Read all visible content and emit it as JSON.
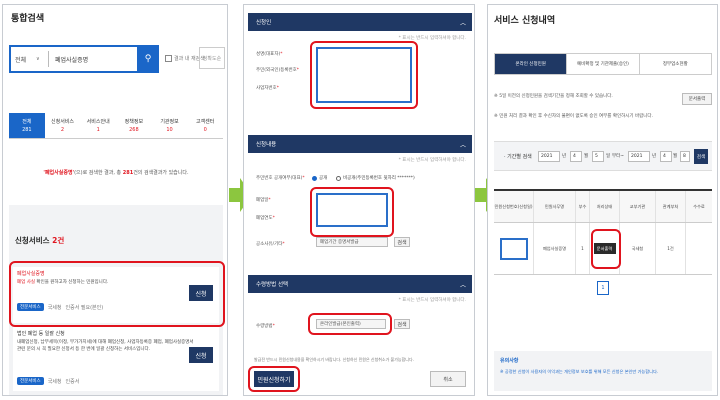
{
  "panel1": {
    "title": "통합검색",
    "search": {
      "scope": "전체",
      "query": "폐업사실증명",
      "checkbox_label": "결과 내 재검색",
      "sort": "정확도순"
    },
    "tabs": [
      {
        "label": "전체",
        "count": "281",
        "active": true
      },
      {
        "label": "신청서비스",
        "count": "2"
      },
      {
        "label": "서비스안내",
        "count": "1"
      },
      {
        "label": "정책정보",
        "count": "268"
      },
      {
        "label": "기관정보",
        "count": "10"
      },
      {
        "label": "고객센터",
        "count": "0"
      }
    ],
    "notice": {
      "keyword": "'폐업사실증명'",
      "pre": "(으)로 검색한 결과, 총 ",
      "total": "281",
      "post": "건의 검색결과가 있습니다."
    },
    "section_title": "신청서비스",
    "section_count": "2건",
    "cards": [
      {
        "title": "폐업사실증명",
        "desc_red": "폐업 사실",
        "desc": " 확인을 원하고자 신청하는 민원입니다.",
        "chip": "전문서비스",
        "org": "국세청",
        "fee": "인증서 필요(본인)",
        "button": "신청"
      },
      {
        "title": "법인 폐업 등 일괄 신청",
        "desc_red": "",
        "desc": "내폐업신청, 납부세목(이정, 부가가치세)에 대해 폐업신청, 사업자등록증 폐업, 폐업사실증명서 관련 문의 시 꼭 필요한 신청서 등 한 번에 일괄 신청하는 서비스입니다.",
        "chip": "전문서비스",
        "org": "국세청",
        "fee": "인증서",
        "button": "신청"
      }
    ]
  },
  "panel2": {
    "sections": [
      {
        "title": "신청인",
        "note": "* 표시는 반드시 입력하셔야 합니다."
      },
      {
        "title": "신청내용",
        "note": "* 표시는 반드시 입력하셔야 합니다."
      },
      {
        "title": "수령방법 선택",
        "note": "* 표시는 반드시 입력하셔야 합니다."
      }
    ],
    "applicant_labels": [
      "성명(대표자)",
      "주민(외국인)등록번호",
      "사업자번호"
    ],
    "content_labels": [
      "주민번호 공개여부(대표)",
      "폐업일",
      "폐업연도",
      "공소사유/기타"
    ],
    "radio_on": "공개",
    "radio_off": "비공개(주민등록번호 뒷자리 *******)",
    "reason_value": "폐업기간 증명서발급",
    "find_label": "검색",
    "receive_label": "수령방법",
    "receive_value": "온라인발급(본인출력)",
    "guide_text": "발급전 반드시 민원신청내용을 확인하시기 바랍니다. 신청하신 민원은 신청취소가 불가능합니다.",
    "submit": "민원신청하기",
    "cancel": "취소"
  },
  "panel3": {
    "title": "서비스 신청내역",
    "tabs": [
      "온라인 신청민원",
      "예비확정 및 기관제출(승인)",
      "정부업소현황"
    ],
    "info1": "※ 5일 이전의 신청민원을 검색기간을 정해 조회할 수 있습니다.",
    "info2": "※ 민원 처리 결과 확인 후 수신자의 불편이 없도록 승인 여부를 확인하시기 바랍니다.",
    "print_button": "문서출력",
    "period_label": "· 기간별 검색",
    "from": {
      "year": "2021",
      "month": "4",
      "day": "5"
    },
    "to": {
      "year": "2021",
      "month": "4",
      "day": "8"
    },
    "y_unit": "년",
    "m_unit": "월",
    "d_unit": "일",
    "range_sep": "부터~",
    "search_button": "검색",
    "columns": [
      "민원신청번호(신청일)",
      "민원사무명",
      "부수",
      "처리상태",
      "교부기관",
      "관계부처",
      "수수료"
    ],
    "row": {
      "name": "폐업사실증명",
      "copies": "1",
      "status": "문서출력",
      "org": "국세청",
      "fee": "1건"
    },
    "page": "1",
    "foot_title": "유의사항",
    "foot_text": "※ 공정한 신청이 사용자의 이익과는 개인정보 보호를 위해 모든 신청은 본인만 가능합니다."
  }
}
